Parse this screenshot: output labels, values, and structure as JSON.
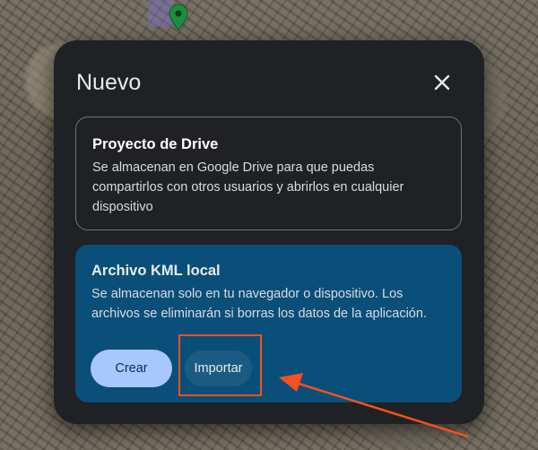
{
  "dialog": {
    "title": "Nuevo"
  },
  "options": {
    "drive": {
      "title": "Proyecto de Drive",
      "description": "Se almacenan en Google Drive para que puedas compartirlos con otros usuarios y abrirlos en cualquier dispositivo"
    },
    "local": {
      "title": "Archivo KML local",
      "description": "Se almacenan solo en tu navegador o dispositivo. Los archivos se eliminarán si borras los datos de la aplicación.",
      "create_label": "Crear",
      "import_label": "Importar"
    }
  },
  "icons": {
    "close": "close-icon",
    "marker": "map-pin-icon"
  },
  "colors": {
    "dialog_bg": "#202124",
    "selected_card_bg": "#0a4f79",
    "primary_button": "#a8c7fa",
    "annotation": "#f4511e",
    "marker": "#1e8e3e"
  }
}
